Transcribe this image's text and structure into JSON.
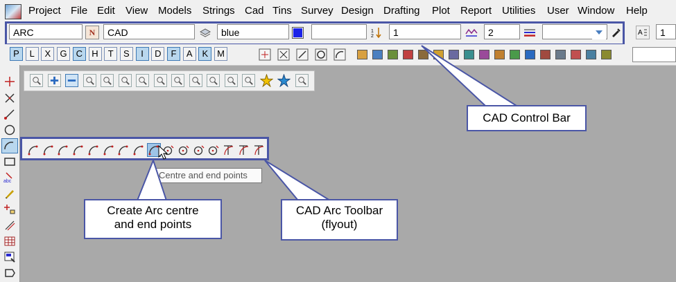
{
  "menubar": {
    "items": [
      "Project",
      "File",
      "Edit",
      "View",
      "Models",
      "Strings",
      "Cad",
      "Tins",
      "Survey",
      "Design",
      "Drafting",
      "Plot",
      "Report",
      "Utilities",
      "User",
      "Window",
      "Help"
    ]
  },
  "cad_control_bar": {
    "model_value": "ARC",
    "name_button": "N",
    "name_value": "CAD",
    "colour_value": "blue",
    "colour_swatch": "#1b22e8",
    "weight_value": "",
    "text_value": "1",
    "line_value": "2",
    "style_value": "",
    "right_value": "1"
  },
  "letter_buttons": [
    {
      "label": "P",
      "on": true
    },
    {
      "label": "L",
      "on": false
    },
    {
      "label": "X",
      "on": false
    },
    {
      "label": "G",
      "on": false
    },
    {
      "label": "C",
      "on": true
    },
    {
      "label": "H",
      "on": false
    },
    {
      "label": "T",
      "on": false
    },
    {
      "label": "S",
      "on": false
    },
    {
      "label": "I",
      "on": true
    },
    {
      "label": "D",
      "on": false
    },
    {
      "label": "F",
      "on": true
    },
    {
      "label": "A",
      "on": false
    },
    {
      "label": "K",
      "on": true
    },
    {
      "label": "M",
      "on": false
    }
  ],
  "tooltip": "Centre and end points",
  "callouts": {
    "cad_control_bar": "CAD Control Bar",
    "create_arc_line1": "Create Arc centre",
    "create_arc_line2": "and end points",
    "arc_toolbar_line1": "CAD Arc Toolbar",
    "arc_toolbar_line2": "(flyout)"
  },
  "colors": {
    "accent": "#4a56a6",
    "background": "#a9a9a9",
    "chrome": "#f0f0f0",
    "selected": "#9ec5e8"
  }
}
